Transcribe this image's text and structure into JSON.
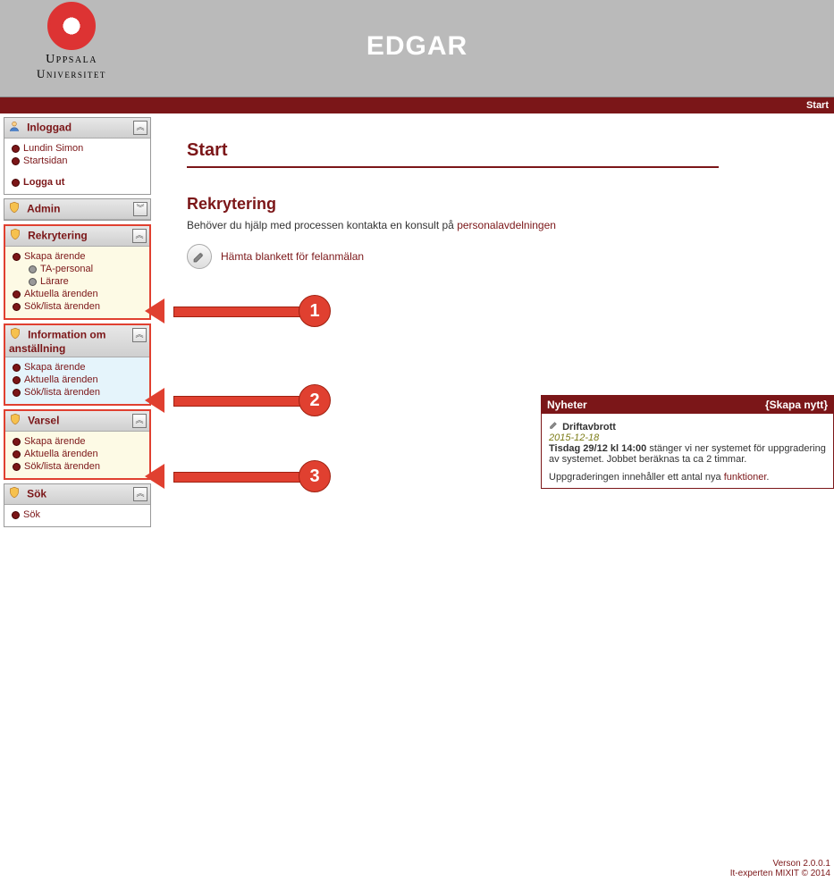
{
  "header": {
    "app_title": "EDGAR",
    "logo_line1": "Uppsala",
    "logo_line2": "Universitet"
  },
  "subheader": {
    "start": "Start"
  },
  "sidebar": {
    "inloggad": {
      "title": "Inloggad",
      "user": "Lundin Simon",
      "home": "Startsidan",
      "logout": "Logga ut"
    },
    "admin": {
      "title": "Admin"
    },
    "rekrytering": {
      "title": "Rekrytering",
      "skapa": "Skapa ärende",
      "ta": "TA-personal",
      "larare": "Lärare",
      "aktuella": "Aktuella ärenden",
      "sok": "Sök/lista ärenden"
    },
    "info": {
      "title": "Information om anställning",
      "skapa": "Skapa ärende",
      "aktuella": "Aktuella ärenden",
      "sok": "Sök/lista ärenden"
    },
    "varsel": {
      "title": "Varsel",
      "skapa": "Skapa ärende",
      "aktuella": "Aktuella ärenden",
      "sok": "Sök/lista ärenden"
    },
    "sok": {
      "title": "Sök",
      "item": "Sök"
    }
  },
  "page": {
    "title": "Start",
    "section_title": "Rekrytering",
    "help_pre": "Behöver du hjälp med processen kontakta en konsult på ",
    "help_link": "personalavdelningen",
    "form_button": "Hämta blankett för felanmälan"
  },
  "news": {
    "head": "Nyheter",
    "create": "{Skapa nytt}",
    "item_title": "Driftavbrott",
    "date": "2015-12-18",
    "line1a": "Tisdag 29/12 kl 14:00",
    "line1b": " stänger vi ner systemet för uppgradering av systemet. Jobbet beräknas ta ca 2 timmar.",
    "line2a": "Uppgraderingen innehåller ett antal nya ",
    "line2b": "funktioner",
    "line2c": "."
  },
  "annotations": {
    "a1": "1",
    "a2": "2",
    "a3": "3"
  },
  "footer": {
    "version": "Verson 2.0.0.1",
    "credit": "It-experten MIXIT © 2014"
  }
}
